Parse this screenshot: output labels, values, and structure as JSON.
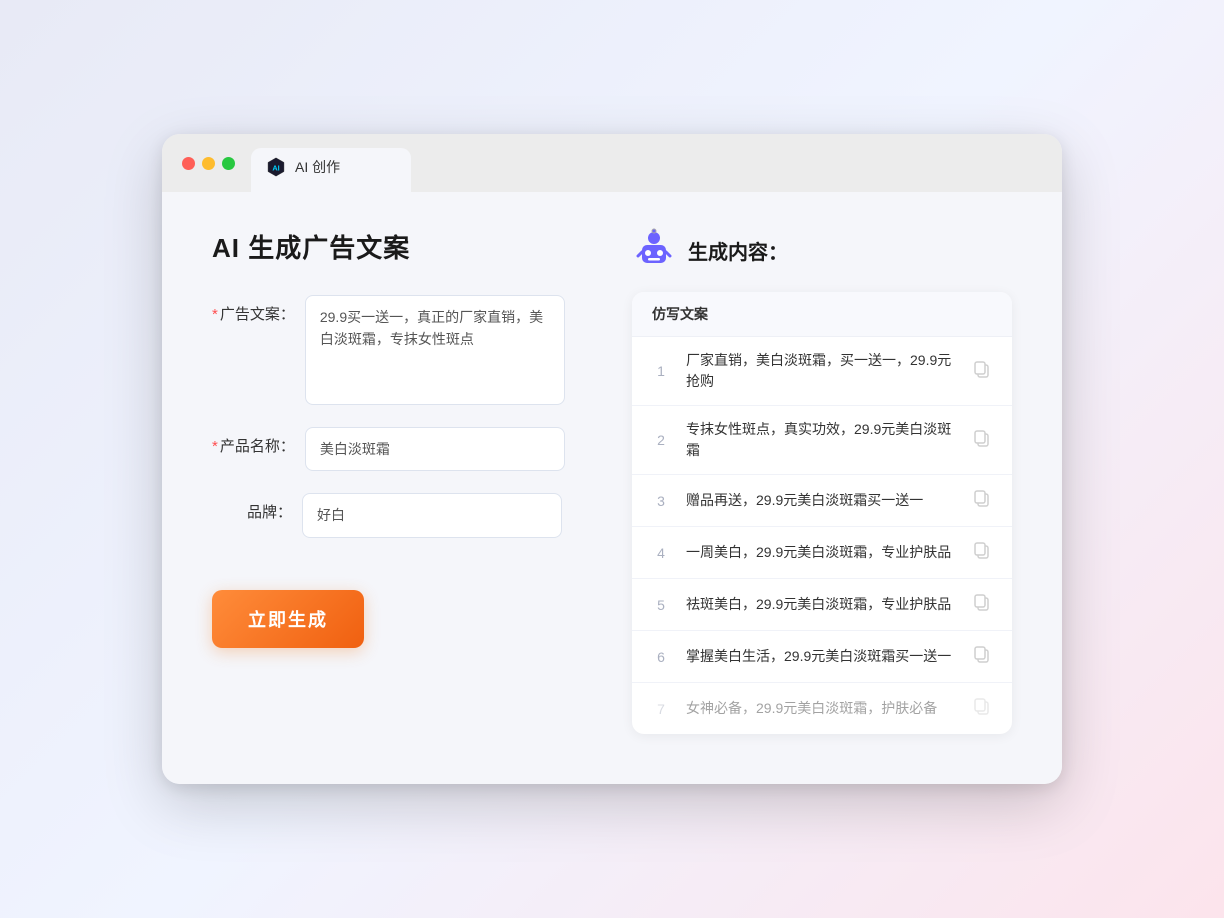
{
  "browser": {
    "tab_label": "AI 创作"
  },
  "page": {
    "title": "AI 生成广告文案"
  },
  "form": {
    "ad_copy_label": "广告文案：",
    "ad_copy_required": "*",
    "ad_copy_value": "29.9买一送一，真正的厂家直销，美白淡斑霜，专抹女性斑点",
    "product_name_label": "产品名称：",
    "product_name_required": "*",
    "product_name_value": "美白淡斑霜",
    "brand_label": "品牌：",
    "brand_value": "好白",
    "generate_button": "立即生成"
  },
  "result": {
    "header": "生成内容：",
    "column_header": "仿写文案",
    "items": [
      {
        "num": "1",
        "text": "厂家直销，美白淡斑霜，买一送一，29.9元抢购"
      },
      {
        "num": "2",
        "text": "专抹女性斑点，真实功效，29.9元美白淡斑霜"
      },
      {
        "num": "3",
        "text": "赠品再送，29.9元美白淡斑霜买一送一"
      },
      {
        "num": "4",
        "text": "一周美白，29.9元美白淡斑霜，专业护肤品"
      },
      {
        "num": "5",
        "text": "祛斑美白，29.9元美白淡斑霜，专业护肤品"
      },
      {
        "num": "6",
        "text": "掌握美白生活，29.9元美白淡斑霜买一送一"
      },
      {
        "num": "7",
        "text": "女神必备，29.9元美白淡斑霜，护肤必备"
      }
    ]
  }
}
